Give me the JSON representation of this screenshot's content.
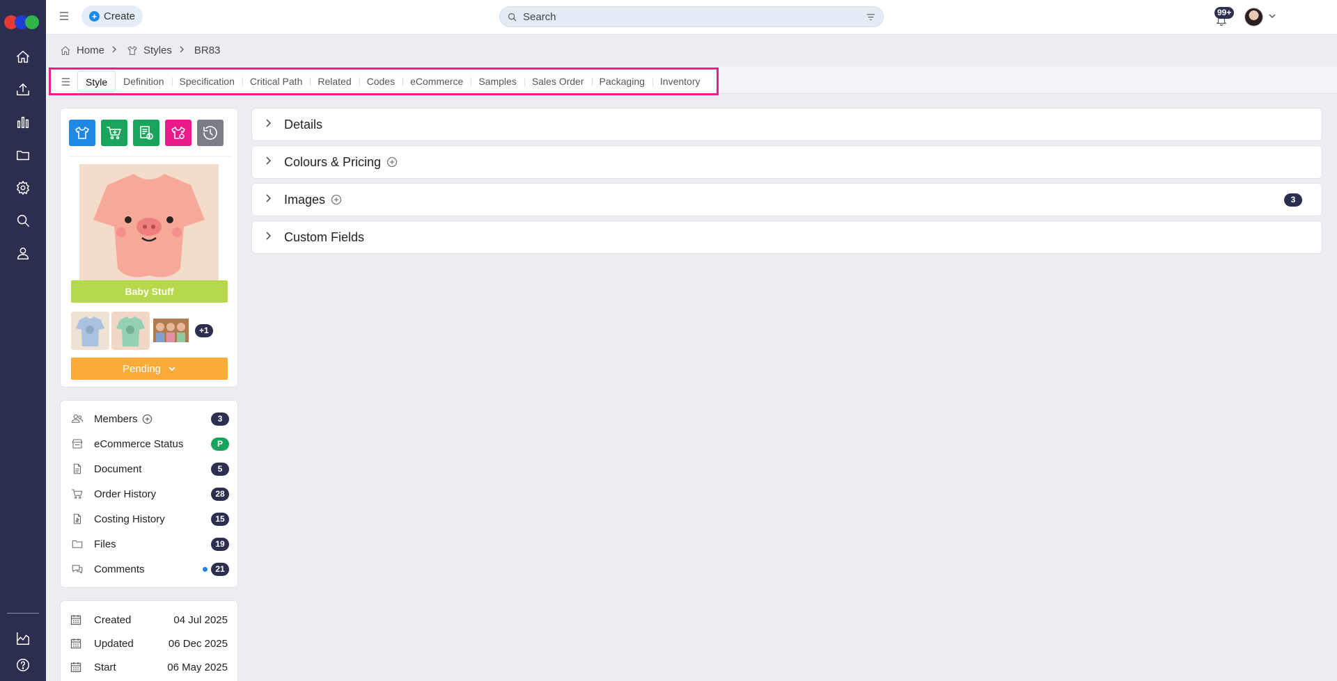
{
  "topbar": {
    "create_label": "Create",
    "search_placeholder": "Search",
    "notifications_count": "99+"
  },
  "breadcrumb": {
    "home": "Home",
    "styles": "Styles",
    "current": "BR83"
  },
  "tabs": [
    "Style",
    "Definition",
    "Specification",
    "Critical Path",
    "Related",
    "Codes",
    "eCommerce",
    "Samples",
    "Sales Order",
    "Packaging",
    "Inventory"
  ],
  "active_tab": "Style",
  "product": {
    "brand": "Baby Stuff",
    "more_images": "+1",
    "status": "Pending"
  },
  "side_list": [
    {
      "label": "Members",
      "count": "3"
    },
    {
      "label": "eCommerce Status",
      "count": "P"
    },
    {
      "label": "Document",
      "count": "5"
    },
    {
      "label": "Order History",
      "count": "28"
    },
    {
      "label": "Costing History",
      "count": "15"
    },
    {
      "label": "Files",
      "count": "19"
    },
    {
      "label": "Comments",
      "count": "21"
    }
  ],
  "dates": [
    {
      "label": "Created",
      "value": "04 Jul 2025"
    },
    {
      "label": "Updated",
      "value": "06 Dec 2025"
    },
    {
      "label": "Start",
      "value": "06 May 2025"
    }
  ],
  "sections": [
    {
      "title": "Details"
    },
    {
      "title": "Colours & Pricing"
    },
    {
      "title": "Images",
      "count": "3"
    },
    {
      "title": "Custom Fields"
    }
  ],
  "colors": {
    "rail": "#2b2e4f",
    "tab_highlight": "#e91e8c",
    "brand_bar": "#b5d94a",
    "status_pending": "#fbab3a",
    "icon_blue": "#1e88e5",
    "icon_green": "#1aa35a",
    "icon_pink": "#ec1b8c",
    "icon_grey": "#7a7d85"
  },
  "icons": {
    "rail": [
      "home-icon",
      "upload-icon",
      "bar-chart-icon",
      "folder-icon",
      "gear-icon",
      "search-icon",
      "user-icon",
      "analytics-icon",
      "help-icon"
    ],
    "actions": [
      "tshirt-icon",
      "cart-add-icon",
      "costing-icon",
      "tshirt-settings-icon",
      "history-icon"
    ]
  }
}
